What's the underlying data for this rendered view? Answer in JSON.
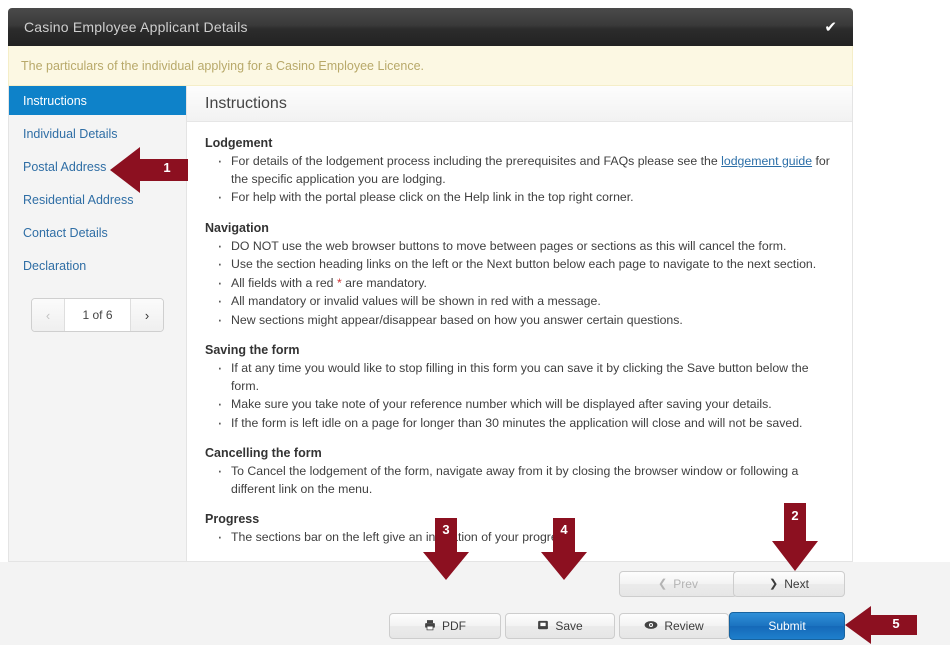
{
  "window": {
    "title": "Casino Employee Applicant Details",
    "status_icon": "check-icon",
    "status_glyph": "✔"
  },
  "notice": {
    "text": "The particulars of the individual applying for a Casino Employee Licence."
  },
  "sidebar": {
    "items": [
      {
        "label": "Instructions",
        "active": true
      },
      {
        "label": "Individual Details",
        "active": false
      },
      {
        "label": "Postal Address",
        "active": false
      },
      {
        "label": "Residential Address",
        "active": false
      },
      {
        "label": "Contact Details",
        "active": false
      },
      {
        "label": "Declaration",
        "active": false
      }
    ],
    "pager": {
      "prev_glyph": "‹",
      "next_glyph": "›",
      "label": "1 of 6",
      "current_page": 1,
      "total_pages": 6
    }
  },
  "content": {
    "heading": "Instructions",
    "sections": [
      {
        "title": "Lodgement",
        "bullets": [
          {
            "before": "For details of the lodgement process including the prerequisites and FAQs please see the ",
            "link": "lodgement guide",
            "after": " for the specific application you are lodging."
          },
          {
            "before": "For help with the portal please click on the Help link in the top right corner."
          }
        ]
      },
      {
        "title": "Navigation",
        "bullets": [
          {
            "before": "DO NOT use the web browser buttons to move between pages or sections as this will cancel the form."
          },
          {
            "before": "Use the section heading links on the left or the Next button below each page to navigate to the next section."
          },
          {
            "before": "All fields with a red ",
            "star": "*",
            "after": " are mandatory."
          },
          {
            "before": "All mandatory or invalid values will be shown in red with a message."
          },
          {
            "before": "New sections might appear/disappear based on how you answer certain questions."
          }
        ]
      },
      {
        "title": "Saving the form",
        "bullets": [
          {
            "before": "If at any time you would like to stop filling in this form you can save it by clicking the Save button below the form."
          },
          {
            "before": "Make sure you take note of your reference number which will be displayed after saving your details."
          },
          {
            "before": "If the form is left idle on a page for longer than 30 minutes the application will close and will not be saved."
          }
        ]
      },
      {
        "title": "Cancelling the form",
        "bullets": [
          {
            "before": "To Cancel the lodgement of the form, navigate away from it by closing the browser window or following a different link on the menu."
          }
        ]
      },
      {
        "title": "Progress",
        "bullets": [
          {
            "before": "The sections bar on the left give an indication of your progress."
          }
        ]
      }
    ]
  },
  "footer": {
    "buttons": {
      "prev": {
        "label": "Prev",
        "icon": "chevron-left-icon",
        "glyph": "❮",
        "disabled": true
      },
      "next": {
        "label": "Next",
        "icon": "chevron-right-icon",
        "glyph": "❯",
        "disabled": false
      },
      "pdf": {
        "label": "PDF",
        "icon": "printer-icon"
      },
      "save": {
        "label": "Save",
        "icon": "save-icon"
      },
      "review": {
        "label": "Review",
        "icon": "eye-icon"
      },
      "submit": {
        "label": "Submit",
        "icon": "none"
      }
    }
  },
  "annotations": [
    {
      "number": "1",
      "direction": "left",
      "target": "sidebar-nav"
    },
    {
      "number": "2",
      "direction": "down",
      "target": "next-button"
    },
    {
      "number": "3",
      "direction": "down",
      "target": "pdf-button"
    },
    {
      "number": "4",
      "direction": "down",
      "target": "save-button"
    },
    {
      "number": "5",
      "direction": "left",
      "target": "submit-button"
    }
  ],
  "colors": {
    "accent_blue": "#0e82c9",
    "submit_blue": "#1b73c0",
    "annotation_red": "#8c1020",
    "notice_bg": "#fcf8e3",
    "titlebar": "#2c2c2c"
  }
}
